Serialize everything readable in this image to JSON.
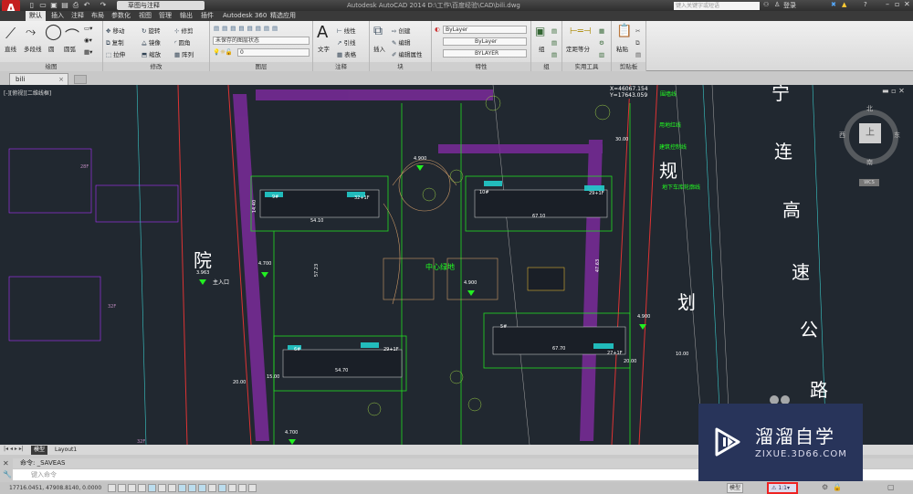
{
  "app": {
    "title": "Autodesk AutoCAD 2014   D:\\工作\\百度经验\\CAD\\bili.dwg",
    "logo": "A",
    "workspace": "草图与注释",
    "search_placeholder": "键入关键字或短语",
    "login": "登录"
  },
  "ribbon_tabs": [
    "默认",
    "插入",
    "注释",
    "布局",
    "参数化",
    "视图",
    "管理",
    "输出",
    "插件",
    "Autodesk 360",
    "精选应用"
  ],
  "panels": {
    "draw": {
      "label": "绘图",
      "items": [
        "直线",
        "多段线",
        "圆",
        "圆弧"
      ]
    },
    "modify": {
      "label": "修改",
      "items": [
        "移动",
        "旋转",
        "修剪",
        "复制",
        "镜像",
        "圆角",
        "拉伸",
        "缩放",
        "阵列"
      ]
    },
    "layers": {
      "label": "图层",
      "state": "未保存的图层状态",
      "current": "0"
    },
    "annotation": {
      "label": "注释",
      "items": [
        "文字",
        "线性",
        "引线",
        "表格"
      ]
    },
    "block": {
      "label": "块",
      "items": [
        "插入",
        "创建",
        "编辑",
        "编辑属性"
      ]
    },
    "properties": {
      "label": "特性",
      "color": "ByLayer",
      "linetype": "ByLayer",
      "lineweight": "BYLAYER"
    },
    "group": {
      "label": "组",
      "items": [
        "组"
      ]
    },
    "utilities": {
      "label": "实用工具",
      "items": [
        "定距等分"
      ]
    },
    "clipboard": {
      "label": "剪贴板",
      "items": [
        "粘贴"
      ]
    }
  },
  "file_tab": "bili",
  "viewport_label": "[-][俯视][二维线框]",
  "viewcube": {
    "north": "北",
    "south": "南",
    "east": "东",
    "west": "西",
    "top": "上",
    "wcs": "WCS"
  },
  "drawing": {
    "road_chars_left": "院",
    "road_chars_right": [
      "规",
      "划"
    ],
    "highway": [
      "宁",
      "连",
      "高",
      "速",
      "公",
      "路"
    ],
    "center": "中心绿地",
    "entrance": "主入口",
    "elevations": [
      "4.900",
      "4.700",
      "3.963",
      "4.900",
      "4.900",
      "4.700"
    ],
    "dims": [
      "54.10",
      "67.10",
      "57.23",
      "54.70",
      "67.70",
      "47.63",
      "14.40",
      "15.00",
      "20.00",
      "20.00",
      "10.00",
      "30.00"
    ],
    "buildings": [
      "9#",
      "10#",
      "6#",
      "5#",
      "32+1F",
      "29+1F",
      "29+1F",
      "27+1F",
      "28F",
      "32F",
      "32F"
    ],
    "legend": [
      "围墙线",
      "用地红线",
      "建筑控制线",
      "地下车库轮廓线"
    ],
    "coords": [
      "X=46067.154",
      "Y=17643.059"
    ]
  },
  "layout_tabs": [
    "模型",
    "Layout1"
  ],
  "command": {
    "history": "命令: _SAVEAS",
    "placeholder": "键入命令"
  },
  "status": {
    "coords": "17716.0451, 47908.8140, 0.0000",
    "model": "模型",
    "scale": "1:1"
  },
  "watermark": {
    "title": "溜溜自学",
    "url": "ZIXUE.3D66.COM"
  }
}
